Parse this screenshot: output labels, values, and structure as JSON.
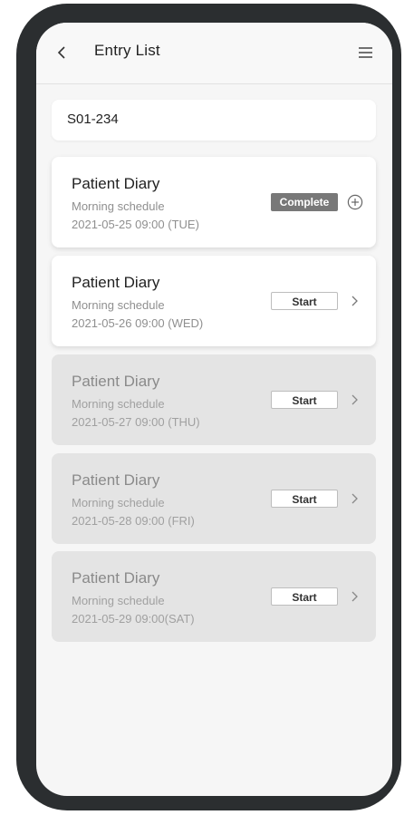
{
  "header": {
    "title": "Entry List",
    "back_icon": "chevron-left-icon",
    "menu_icon": "hamburger-menu-icon"
  },
  "subject_id": "S01-234",
  "entries": [
    {
      "title": "Patient Diary",
      "schedule": "Morning schedule",
      "datetime": "2021-05-25 09:00 (TUE)",
      "status_label": "Complete",
      "trailing_icon": "plus-circle-icon"
    },
    {
      "title": "Patient Diary",
      "schedule": "Morning schedule",
      "datetime": "2021-05-26 09:00 (WED)",
      "status_label": "Start",
      "trailing_icon": "chevron-right-icon"
    },
    {
      "title": "Patient Diary",
      "schedule": "Morning schedule",
      "datetime": "2021-05-27 09:00 (THU)",
      "status_label": "Start",
      "trailing_icon": "chevron-right-icon"
    },
    {
      "title": "Patient Diary",
      "schedule": "Morning schedule",
      "datetime": "2021-05-28 09:00 (FRI)",
      "status_label": "Start",
      "trailing_icon": "chevron-right-icon"
    },
    {
      "title": "Patient Diary",
      "schedule": "Morning schedule",
      "datetime": "2021-05-29 09:00(SAT)",
      "status_label": "Start",
      "trailing_icon": "chevron-right-icon"
    }
  ],
  "colors": {
    "frame": "#2b2e30",
    "screen_bg": "#f6f6f6",
    "card_active": "#ffffff",
    "card_inactive": "#e4e4e4",
    "complete_badge": "#787878"
  }
}
